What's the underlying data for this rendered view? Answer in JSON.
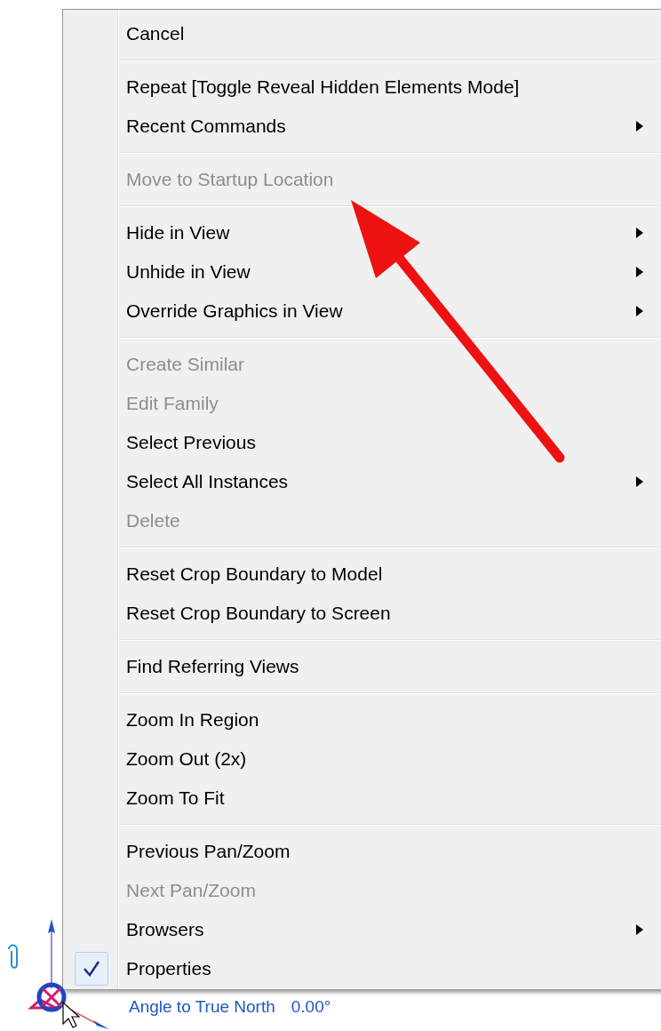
{
  "context_menu": {
    "groups": [
      {
        "items": [
          {
            "label": "Cancel",
            "disabled": false,
            "submenu": false,
            "checked": false
          }
        ]
      },
      {
        "items": [
          {
            "label": "Repeat [Toggle Reveal Hidden Elements Mode]",
            "disabled": false,
            "submenu": false,
            "checked": false
          },
          {
            "label": "Recent Commands",
            "disabled": false,
            "submenu": true,
            "checked": false
          }
        ]
      },
      {
        "items": [
          {
            "label": "Move to Startup Location",
            "disabled": true,
            "submenu": false,
            "checked": false
          }
        ]
      },
      {
        "items": [
          {
            "label": "Hide in View",
            "disabled": false,
            "submenu": true,
            "checked": false
          },
          {
            "label": "Unhide in View",
            "disabled": false,
            "submenu": true,
            "checked": false
          },
          {
            "label": "Override Graphics in View",
            "disabled": false,
            "submenu": true,
            "checked": false
          }
        ]
      },
      {
        "items": [
          {
            "label": "Create Similar",
            "disabled": true,
            "submenu": false,
            "checked": false
          },
          {
            "label": "Edit Family",
            "disabled": true,
            "submenu": false,
            "checked": false
          },
          {
            "label": "Select Previous",
            "disabled": false,
            "submenu": false,
            "checked": false
          },
          {
            "label": "Select All Instances",
            "disabled": false,
            "submenu": true,
            "checked": false
          },
          {
            "label": "Delete",
            "disabled": true,
            "submenu": false,
            "checked": false
          }
        ]
      },
      {
        "items": [
          {
            "label": "Reset Crop Boundary to Model",
            "disabled": false,
            "submenu": false,
            "checked": false
          },
          {
            "label": "Reset Crop Boundary to Screen",
            "disabled": false,
            "submenu": false,
            "checked": false
          }
        ]
      },
      {
        "items": [
          {
            "label": "Find Referring Views",
            "disabled": false,
            "submenu": false,
            "checked": false
          }
        ]
      },
      {
        "items": [
          {
            "label": "Zoom In Region",
            "disabled": false,
            "submenu": false,
            "checked": false
          },
          {
            "label": "Zoom Out (2x)",
            "disabled": false,
            "submenu": false,
            "checked": false
          },
          {
            "label": "Zoom To Fit",
            "disabled": false,
            "submenu": false,
            "checked": false
          }
        ]
      },
      {
        "items": [
          {
            "label": "Previous Pan/Zoom",
            "disabled": false,
            "submenu": false,
            "checked": false
          },
          {
            "label": "Next Pan/Zoom",
            "disabled": true,
            "submenu": false,
            "checked": false
          },
          {
            "label": "Browsers",
            "disabled": false,
            "submenu": true,
            "checked": false
          },
          {
            "label": "Properties",
            "disabled": false,
            "submenu": false,
            "checked": true
          }
        ]
      }
    ]
  },
  "canvas": {
    "angle_label": "Angle to True North",
    "angle_value": "0.00°"
  }
}
